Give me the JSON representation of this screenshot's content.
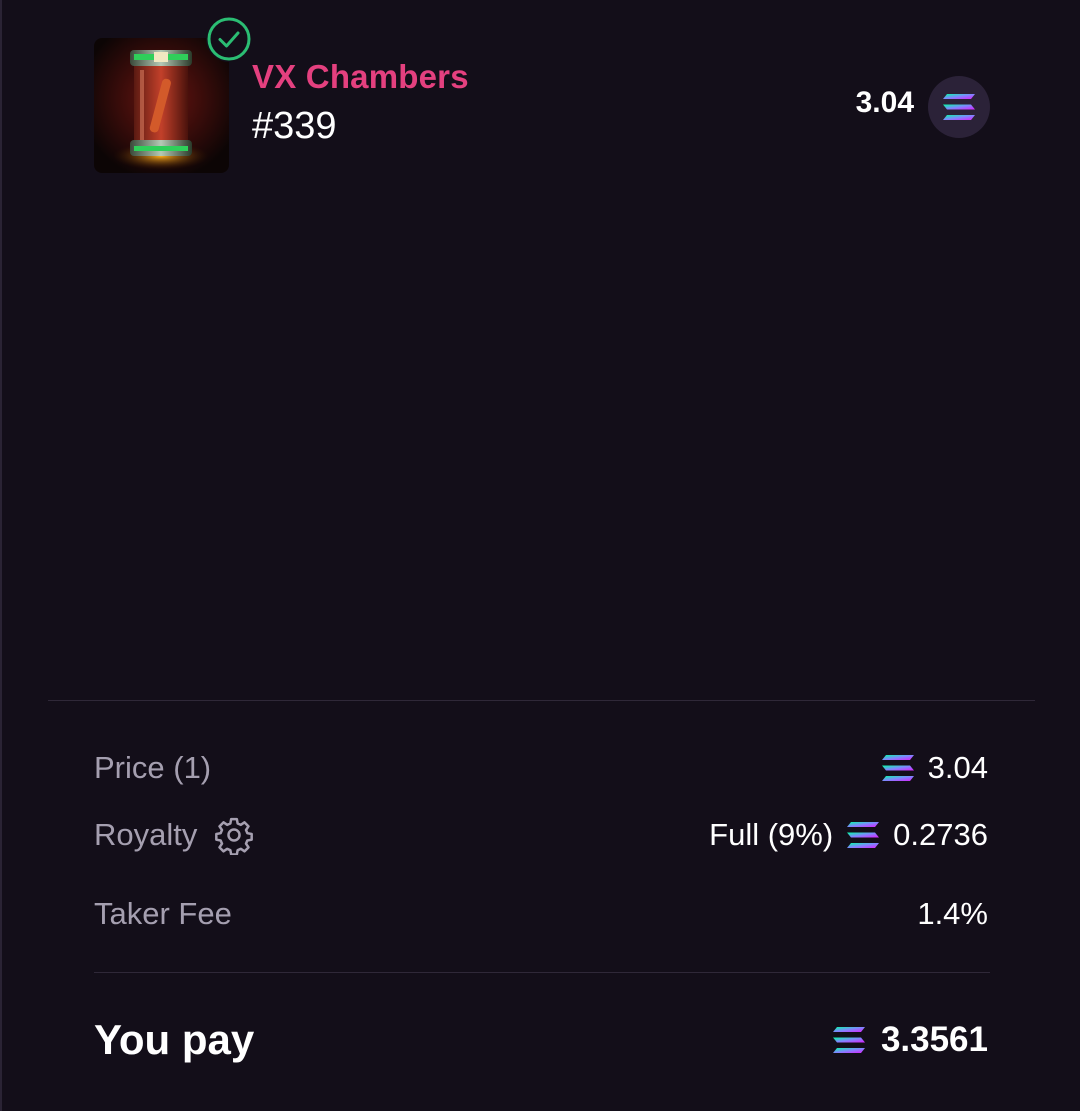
{
  "item": {
    "collection": "VX Chambers",
    "token": "#339",
    "price": "3.04",
    "verified_icon": "check-circle-icon",
    "currency_icon": "solana-icon"
  },
  "summary": {
    "price_label": "Price (1)",
    "price_value": "3.04",
    "royalty_label": "Royalty",
    "royalty_mode": "Full (9%)",
    "royalty_value": "0.2736",
    "royalty_settings_icon": "gear-icon",
    "taker_fee_label": "Taker Fee",
    "taker_fee_value": "1.4%",
    "you_pay_label": "You pay",
    "you_pay_value": "3.3561"
  },
  "colors": {
    "background": "#130e19",
    "collection_accent": "#e4407f",
    "verified_green": "#2bbd73",
    "label_gray": "#a59fb0"
  }
}
